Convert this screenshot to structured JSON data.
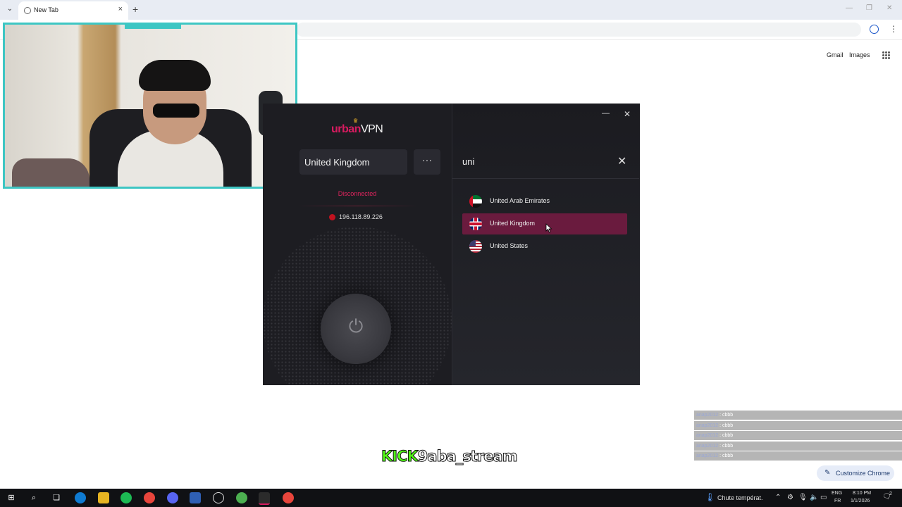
{
  "browser": {
    "tab_title": "New Tab",
    "new_tab_symbol": "+",
    "close_symbol": "×",
    "header_links": [
      "Gmail",
      "Images"
    ],
    "customize_label": "Customize Chrome"
  },
  "vpn": {
    "brand_part1": "urban",
    "brand_part2": "VPN",
    "selected_location": "United Kingdom",
    "more_symbol": "···",
    "status": "Disconnected",
    "ip_address": "196.118.89.226",
    "search_query": "uni",
    "results": [
      {
        "name": "United Arab Emirates",
        "flag": "uae-flag",
        "selected": false
      },
      {
        "name": "United Kingdom",
        "flag": "uk-flag",
        "selected": true
      },
      {
        "name": "United States",
        "flag": "us-flag",
        "selected": false
      }
    ],
    "accent_color": "#d81b60",
    "selected_row_color": "#6a1b3e"
  },
  "chat": {
    "rows": [
      {
        "user": "anap2012",
        "sep": " : ",
        "msg": "cbbb"
      },
      {
        "user": "anap2012",
        "sep": " : ",
        "msg": "cbbb"
      },
      {
        "user": "anap2012",
        "sep": " : ",
        "msg": "cbbb"
      },
      {
        "user": "anap2012",
        "sep": " : ",
        "msg": "cbbb"
      },
      {
        "user": "anap2012",
        "sep": " : ",
        "msg": "cbbb"
      }
    ]
  },
  "stream_banner": {
    "platform": "KICK",
    "handle": "9aba_stream",
    "platform_color": "#53fc18"
  },
  "taskbar": {
    "weather": "Chute températ.",
    "lang_line1": "ENG",
    "lang_line2": "FR",
    "time": "8:10 PM",
    "date": "1/1/2026",
    "notification_count": "2"
  }
}
